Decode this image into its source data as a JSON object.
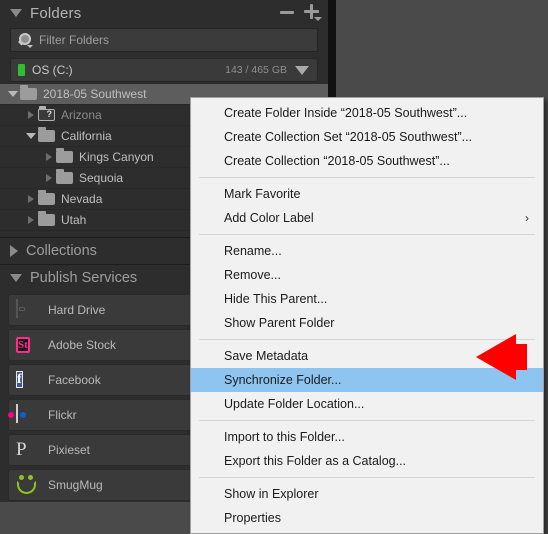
{
  "panel": {
    "folders_header": {
      "title": "Folders",
      "disclosure": "triangle-down",
      "minus_icon": "minus-icon",
      "plus_icon": "plus-icon"
    },
    "filter": {
      "placeholder": "Filter Folders",
      "icon": "search-icon"
    },
    "drive": {
      "name": "OS (C:)",
      "space": "143 / 465 GB",
      "led_color": "#2fbf2f",
      "caret_icon": "chevron-down-icon"
    },
    "tree": [
      {
        "label": "2018-05 Southwest",
        "indent": 0,
        "disclosure": "down",
        "icon": "folder-icon",
        "selected": true,
        "count": ""
      },
      {
        "label": "Arizona",
        "indent": 1,
        "disclosure": "right",
        "icon": "folder-missing-icon",
        "selected": false,
        "count": ""
      },
      {
        "label": "California",
        "indent": 1,
        "disclosure": "down",
        "icon": "folder-icon",
        "selected": false,
        "count": ""
      },
      {
        "label": "Kings Canyon",
        "indent": 2,
        "disclosure": "right",
        "icon": "folder-icon",
        "selected": false,
        "count": ""
      },
      {
        "label": "Sequoia",
        "indent": 2,
        "disclosure": "right",
        "icon": "folder-icon",
        "selected": false,
        "count": ""
      },
      {
        "label": "Nevada",
        "indent": 1,
        "disclosure": "right",
        "icon": "folder-icon",
        "selected": false,
        "count": ""
      },
      {
        "label": "Utah",
        "indent": 1,
        "disclosure": "right",
        "icon": "folder-icon",
        "selected": false,
        "count": ""
      }
    ],
    "collections": {
      "title": "Collections",
      "disclosure": "triangle-right"
    },
    "publish_services": {
      "title": "Publish Services",
      "disclosure": "triangle-down",
      "items": [
        {
          "label": "Hard Drive",
          "icon": "hard-drive-icon"
        },
        {
          "label": "Adobe Stock",
          "icon": "adobe-stock-icon",
          "glyph": "St"
        },
        {
          "label": "Facebook",
          "icon": "facebook-icon",
          "glyph": "f"
        },
        {
          "label": "Flickr",
          "icon": "flickr-icon"
        },
        {
          "label": "Pixieset",
          "icon": "pixieset-icon",
          "glyph": "P"
        },
        {
          "label": "SmugMug",
          "icon": "smugmug-icon"
        }
      ]
    }
  },
  "context_menu": {
    "groups": [
      {
        "items": [
          {
            "label": "Create Folder Inside “2018-05 Southwest”...",
            "highlighted": false,
            "submenu": false
          },
          {
            "label": "Create Collection Set “2018-05 Southwest”...",
            "highlighted": false,
            "submenu": false
          },
          {
            "label": "Create Collection “2018-05 Southwest”...",
            "highlighted": false,
            "submenu": false
          }
        ]
      },
      {
        "items": [
          {
            "label": "Mark Favorite",
            "highlighted": false,
            "submenu": false
          },
          {
            "label": "Add Color Label",
            "highlighted": false,
            "submenu": true,
            "submenu_glyph": "›"
          }
        ]
      },
      {
        "items": [
          {
            "label": "Rename...",
            "highlighted": false,
            "submenu": false
          },
          {
            "label": "Remove...",
            "highlighted": false,
            "submenu": false
          },
          {
            "label": "Hide This Parent...",
            "highlighted": false,
            "submenu": false
          },
          {
            "label": "Show Parent Folder",
            "highlighted": false,
            "submenu": false
          }
        ]
      },
      {
        "items": [
          {
            "label": "Save Metadata",
            "highlighted": false,
            "submenu": false
          },
          {
            "label": "Synchronize Folder...",
            "highlighted": true,
            "submenu": false
          },
          {
            "label": "Update Folder Location...",
            "highlighted": false,
            "submenu": false
          }
        ]
      },
      {
        "items": [
          {
            "label": "Import to this Folder...",
            "highlighted": false,
            "submenu": false
          },
          {
            "label": "Export this Folder as a Catalog...",
            "highlighted": false,
            "submenu": false
          }
        ]
      },
      {
        "items": [
          {
            "label": "Show in Explorer",
            "highlighted": false,
            "submenu": false
          },
          {
            "label": "Properties",
            "highlighted": false,
            "submenu": false
          }
        ]
      }
    ],
    "highlight_color": "#8ec5f0"
  },
  "annotation": {
    "arrow": "red-arrow-pointer",
    "color": "#ff0000",
    "points_to": "Synchronize Folder..."
  }
}
